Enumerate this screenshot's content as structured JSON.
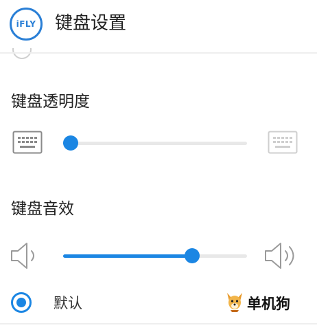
{
  "header": {
    "logo_text": "iFLY",
    "title": "键盘设置"
  },
  "transparency": {
    "label": "键盘透明度",
    "left_icon": "keyboard-icon",
    "right_icon": "keyboard-faded-icon",
    "value_fraction": 0.0
  },
  "sound": {
    "label": "键盘音效",
    "left_icon": "speaker-low-icon",
    "right_icon": "speaker-high-icon",
    "value_fraction": 0.72
  },
  "sound_option": {
    "label": "默认",
    "selected": true
  },
  "watermark": {
    "text": "单机狗",
    "icon": "dog-mascot-icon"
  },
  "colors": {
    "accent": "#1b86e3",
    "track": "#e8e8e8",
    "logo": "#2a7fd6"
  }
}
